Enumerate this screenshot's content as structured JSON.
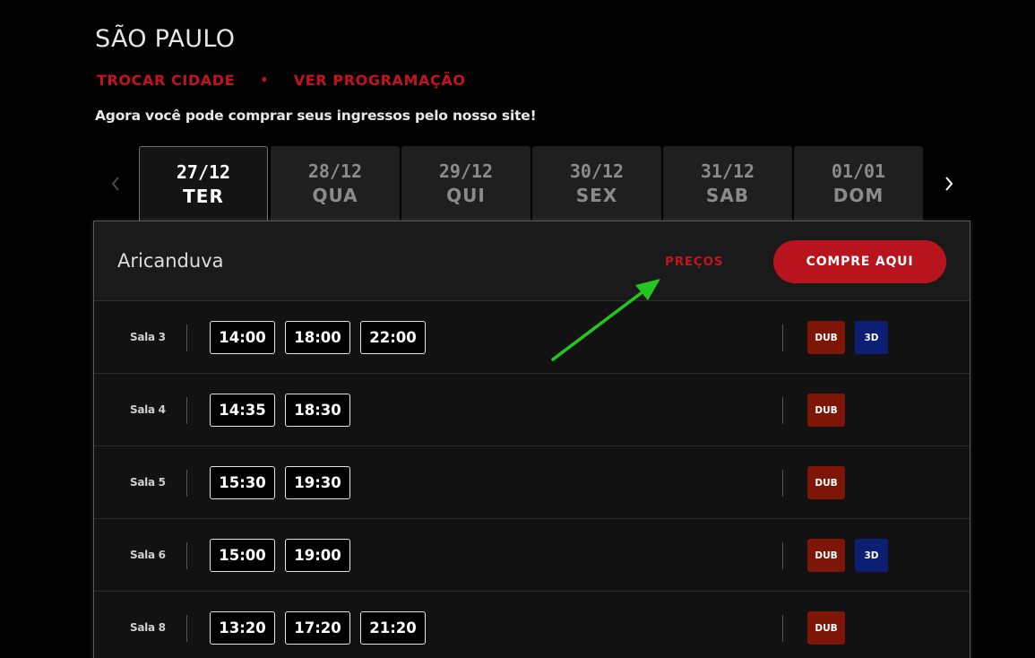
{
  "header": {
    "city": "SÃO PAULO",
    "change_city": "TROCAR CIDADE",
    "separator": "•",
    "see_schedule": "VER PROGRAMAÇÃO",
    "info": "Agora você pode comprar seus ingressos pelo nosso site!"
  },
  "dates": [
    {
      "date": "27/12",
      "weekday": "TER",
      "active": true
    },
    {
      "date": "28/12",
      "weekday": "QUA",
      "active": false
    },
    {
      "date": "29/12",
      "weekday": "QUI",
      "active": false
    },
    {
      "date": "30/12",
      "weekday": "SEX",
      "active": false
    },
    {
      "date": "31/12",
      "weekday": "SAB",
      "active": false
    },
    {
      "date": "01/01",
      "weekday": "DOM",
      "active": false
    }
  ],
  "cinema": {
    "name": "Aricanduva",
    "prices_label": "PREÇOS",
    "buy_label": "COMPRE AQUI"
  },
  "sessions": [
    {
      "room": "Sala 3",
      "times": [
        "14:00",
        "18:00",
        "22:00"
      ],
      "badges": [
        "DUB",
        "3D"
      ]
    },
    {
      "room": "Sala 4",
      "times": [
        "14:35",
        "18:30"
      ],
      "badges": [
        "DUB"
      ]
    },
    {
      "room": "Sala 5",
      "times": [
        "15:30",
        "19:30"
      ],
      "badges": [
        "DUB"
      ]
    },
    {
      "room": "Sala 6",
      "times": [
        "15:00",
        "19:00"
      ],
      "badges": [
        "DUB",
        "3D"
      ]
    },
    {
      "room": "Sala 8",
      "times": [
        "13:20",
        "17:20",
        "21:20"
      ],
      "badges": [
        "DUB"
      ]
    }
  ],
  "colors": {
    "accent_red": "#c4131f",
    "dub_badge": "#7d1607",
    "3d_badge": "#0d1f72",
    "annotation_arrow": "#22c722"
  },
  "icons": {
    "prev": "chevron-left-icon",
    "next": "chevron-right-icon",
    "annotation": "arrow-annotation-icon"
  }
}
